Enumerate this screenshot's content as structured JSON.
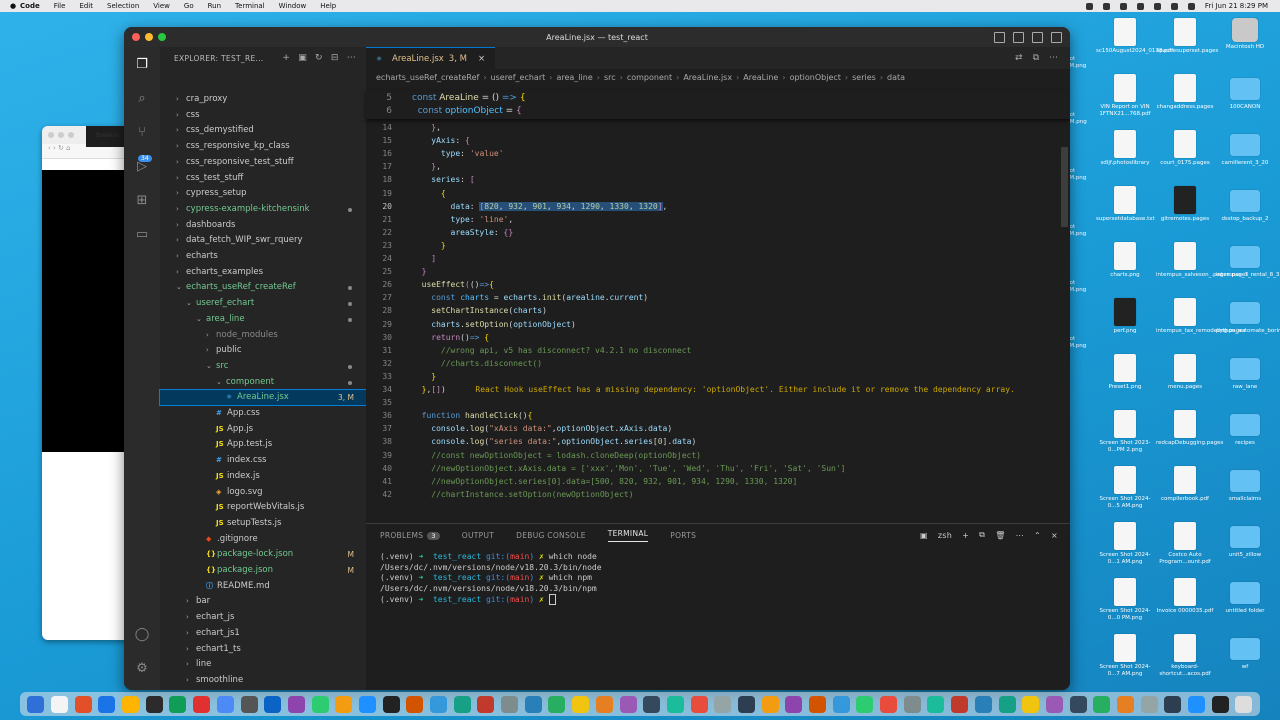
{
  "menubar": {
    "app": "Code",
    "items": [
      "File",
      "Edit",
      "Selection",
      "View",
      "Go",
      "Run",
      "Terminal",
      "Window",
      "Help"
    ],
    "clock": "Fri Jun 21  8:29 PM"
  },
  "browser": {
    "tab_label": "Breakin"
  },
  "desktop_icons": [
    {
      "label": "sc150August2024_0178.pdf"
    },
    {
      "label": "apachesuperset.pages"
    },
    {
      "label": "Macintosh HD"
    },
    {
      "label": "VIN Report on VIN 1FTNX21...768.pdf"
    },
    {
      "label": "changaddress.pages"
    },
    {
      "label": "100CANON"
    },
    {
      "label": "sdljf.photoslibrary"
    },
    {
      "label": "court_0175.pages"
    },
    {
      "label": "camillerent_3_20"
    },
    {
      "label": "supersetdatabase.txt"
    },
    {
      "label": "gitremotes.pages"
    },
    {
      "label": "dsstop_backup_2"
    },
    {
      "label": "charts.png"
    },
    {
      "label": "intempus_salveson_.pages.pages"
    },
    {
      "label": "intempus_7_rental_8_31_2023"
    },
    {
      "label": "perf.png"
    },
    {
      "label": "intempus_tax_remodeling.pages"
    },
    {
      "label": "python_automate_boring"
    },
    {
      "label": "Preset1.png"
    },
    {
      "label": "menu.pages"
    },
    {
      "label": "raw_lane"
    },
    {
      "label": "Screen Shot 2023-0...PM 2.png"
    },
    {
      "label": "redcapDebugging.pages"
    },
    {
      "label": "recipes"
    },
    {
      "label": "Screen Shot 2024-0...5 AM.png"
    },
    {
      "label": "compilerbook.pdf"
    },
    {
      "label": "smallclaims"
    },
    {
      "label": "Screen Shot 2024-0...1 AM.png"
    },
    {
      "label": "Costco Auto Program...ount.pdf"
    },
    {
      "label": "unit5_zillow"
    },
    {
      "label": "Screen Shot 2024-0...0 PM.png"
    },
    {
      "label": "Invoice 0000035.pdf"
    },
    {
      "label": "untitled folder"
    },
    {
      "label": "Screen Shot 2024-0...7 AM.png"
    },
    {
      "label": "keyboard-shortcut...acos.pdf"
    },
    {
      "label": "wf"
    }
  ],
  "desktop_partial": [
    "hot",
    "PM.png",
    "hot",
    "AM.png",
    "hot",
    "PM.png",
    "hot",
    "PM.png",
    "hot",
    "PM.png",
    "hot",
    "PM.png"
  ],
  "window": {
    "title": "AreaLine.jsx — test_react",
    "explorer_title": "EXPLORER: TEST_RE...",
    "badge_count": "34"
  },
  "tree": [
    {
      "label": "cra_proxy",
      "indent": 0,
      "type": "folder",
      "open": false
    },
    {
      "label": "css",
      "indent": 0,
      "type": "folder",
      "open": false
    },
    {
      "label": "css_demystified",
      "indent": 0,
      "type": "folder",
      "open": false
    },
    {
      "label": "css_responsive_kp_class",
      "indent": 0,
      "type": "folder",
      "open": false
    },
    {
      "label": "css_responsive_test_stuff",
      "indent": 0,
      "type": "folder",
      "open": false
    },
    {
      "label": "css_test_stuff",
      "indent": 0,
      "type": "folder",
      "open": false
    },
    {
      "label": "cypress_setup",
      "indent": 0,
      "type": "folder",
      "open": false
    },
    {
      "label": "cypress-example-kitchensink",
      "indent": 0,
      "type": "folder",
      "open": false,
      "green": true,
      "dot": true
    },
    {
      "label": "dashboards",
      "indent": 0,
      "type": "folder",
      "open": false
    },
    {
      "label": "data_fetch_WIP_swr_rquery",
      "indent": 0,
      "type": "folder",
      "open": false
    },
    {
      "label": "echarts",
      "indent": 0,
      "type": "folder",
      "open": false
    },
    {
      "label": "echarts_examples",
      "indent": 0,
      "type": "folder",
      "open": false
    },
    {
      "label": "echarts_useRef_createRef",
      "indent": 0,
      "type": "folder",
      "open": true,
      "green": true,
      "dot": true
    },
    {
      "label": "useref_echart",
      "indent": 1,
      "type": "folder",
      "open": true,
      "green": true,
      "dot": true
    },
    {
      "label": "area_line",
      "indent": 2,
      "type": "folder",
      "open": true,
      "green": true,
      "dot": true
    },
    {
      "label": "node_modules",
      "indent": 3,
      "type": "folder",
      "open": false,
      "dim": true
    },
    {
      "label": "public",
      "indent": 3,
      "type": "folder",
      "open": false
    },
    {
      "label": "src",
      "indent": 3,
      "type": "folder",
      "open": true,
      "green": true,
      "dot": true
    },
    {
      "label": "component",
      "indent": 4,
      "type": "folder",
      "open": true,
      "green": true,
      "dot": true
    },
    {
      "label": "AreaLine.jsx",
      "indent": 5,
      "type": "file",
      "icon": "jsx",
      "green": true,
      "selected": true,
      "mod": "3, M"
    },
    {
      "label": "App.css",
      "indent": 4,
      "type": "file",
      "icon": "css"
    },
    {
      "label": "App.js",
      "indent": 4,
      "type": "file",
      "icon": "js"
    },
    {
      "label": "App.test.js",
      "indent": 4,
      "type": "file",
      "icon": "js"
    },
    {
      "label": "index.css",
      "indent": 4,
      "type": "file",
      "icon": "css"
    },
    {
      "label": "index.js",
      "indent": 4,
      "type": "file",
      "icon": "js"
    },
    {
      "label": "logo.svg",
      "indent": 4,
      "type": "file",
      "icon": "svg"
    },
    {
      "label": "reportWebVitals.js",
      "indent": 4,
      "type": "file",
      "icon": "js"
    },
    {
      "label": "setupTests.js",
      "indent": 4,
      "type": "file",
      "icon": "js"
    },
    {
      "label": ".gitignore",
      "indent": 3,
      "type": "file",
      "icon": "git"
    },
    {
      "label": "package-lock.json",
      "indent": 3,
      "type": "file",
      "icon": "json",
      "green": true,
      "mod": "M"
    },
    {
      "label": "package.json",
      "indent": 3,
      "type": "file",
      "icon": "json",
      "green": true,
      "mod": "M"
    },
    {
      "label": "README.md",
      "indent": 3,
      "type": "file",
      "icon": "md"
    },
    {
      "label": "bar",
      "indent": 1,
      "type": "folder",
      "open": false
    },
    {
      "label": "echart_js",
      "indent": 1,
      "type": "folder",
      "open": false
    },
    {
      "label": "echart_js1",
      "indent": 1,
      "type": "folder",
      "open": false
    },
    {
      "label": "echart1_ts",
      "indent": 1,
      "type": "folder",
      "open": false
    },
    {
      "label": "line",
      "indent": 1,
      "type": "folder",
      "open": false
    },
    {
      "label": "smoothline",
      "indent": 1,
      "type": "folder",
      "open": false
    },
    {
      "label": "useref_js",
      "indent": 1,
      "type": "folder",
      "open": false
    }
  ],
  "editor_tab": {
    "label": "AreaLine.jsx",
    "status": "3, M"
  },
  "breadcrumb": [
    "echarts_useRef_createRef",
    "useref_echart",
    "area_line",
    "src",
    "component",
    "AreaLine.jsx",
    "AreaLine",
    "optionObject",
    "series",
    "data"
  ],
  "sticky": [
    {
      "ln": "5",
      "html": "<span class=\"kw\">const</span> <span class=\"fn\">AreaLine</span> = () <span class=\"kw\">=&gt;</span> <span class=\"br\">{</span>"
    },
    {
      "ln": "6",
      "html": "  <span class=\"kw\">const</span> <span class=\"cst\">optionObject</span> = <span class=\"ctl\">{</span>"
    }
  ],
  "code": [
    {
      "ln": "14",
      "html": "    <span class=\"ctl\">}</span>,"
    },
    {
      "ln": "15",
      "html": "    <span class=\"var\">yAxis</span>: <span class=\"ctl\">{</span>"
    },
    {
      "ln": "16",
      "html": "      <span class=\"var\">type</span>: <span class=\"str\">'value'</span>"
    },
    {
      "ln": "17",
      "html": "    <span class=\"ctl\">}</span>,"
    },
    {
      "ln": "18",
      "html": "    <span class=\"var\">series</span>: <span class=\"ctl\">[</span>"
    },
    {
      "ln": "19",
      "html": "      <span class=\"br\">{</span>"
    },
    {
      "ln": "20",
      "html": "        <span class=\"var\">data</span>: <span class=\"sel-bg\"><span class=\"ctl\">[</span><span class=\"num\">820</span>, <span class=\"num\">932</span>, <span class=\"num\">901</span>, <span class=\"num\">934</span>, <span class=\"num\">1290</span>, <span class=\"num\">1330</span>, <span class=\"num\">1320</span><span class=\"ctl\">]</span></span>,",
      "current": true
    },
    {
      "ln": "21",
      "html": "        <span class=\"var\">type</span>: <span class=\"str\">'line'</span>,"
    },
    {
      "ln": "22",
      "html": "        <span class=\"var\">areaStyle</span>: <span class=\"ctl\">{}</span>"
    },
    {
      "ln": "23",
      "html": "      <span class=\"br\">}</span>"
    },
    {
      "ln": "24",
      "html": "    <span class=\"ctl\">]</span>"
    },
    {
      "ln": "25",
      "html": "  <span class=\"ctl\">}</span>"
    },
    {
      "ln": "26",
      "html": "  <span class=\"fn\">useEffect</span><span class=\"ctl\">(</span>()<span class=\"kw\">=&gt;</span><span class=\"br\">{</span>"
    },
    {
      "ln": "27",
      "html": "    <span class=\"kw\">const</span> <span class=\"cst\">charts</span> = <span class=\"var\">echarts</span>.<span class=\"fn\">init</span>(<span class=\"var\">arealine</span>.<span class=\"var\">current</span>)"
    },
    {
      "ln": "28",
      "html": "    <span class=\"fn\">setChartInstance</span>(<span class=\"var\">charts</span>)"
    },
    {
      "ln": "29",
      "html": "    <span class=\"var\">charts</span>.<span class=\"fn\">setOption</span>(<span class=\"var\">optionObject</span>)"
    },
    {
      "ln": "30",
      "html": "    <span class=\"ctl\">return</span>()<span class=\"kw\">=&gt;</span> <span class=\"br\">{</span>"
    },
    {
      "ln": "31",
      "html": "      <span class=\"cm\">//wrong api, v5 has disconnect? v4.2.1 no disconnect</span>"
    },
    {
      "ln": "32",
      "html": "      <span class=\"cm\">//charts.disconnect()</span>"
    },
    {
      "ln": "33",
      "html": "    <span class=\"br\">}</span>"
    },
    {
      "ln": "34",
      "html": "  <span class=\"br\">}</span>,<span class=\"ctl\">[]</span>)  <span class=\"warn\">React Hook useEffect has a missing dependency: 'optionObject'. Either include it or remove the dependency array.</span>"
    },
    {
      "ln": "35",
      "html": ""
    },
    {
      "ln": "36",
      "html": "  <span class=\"kw\">function</span> <span class=\"fn\">handleClick</span>()<span class=\"br\">{</span>"
    },
    {
      "ln": "37",
      "html": "    <span class=\"var\">console</span>.<span class=\"fn\">log</span>(<span class=\"str\">\"xAxis data:\"</span>,<span class=\"var\">optionObject</span>.<span class=\"var\">xAxis</span>.<span class=\"var\">data</span>)"
    },
    {
      "ln": "38",
      "html": "    <span class=\"var\">console</span>.<span class=\"fn\">log</span>(<span class=\"str\">\"series data:\"</span>,<span class=\"var\">optionObject</span>.<span class=\"var\">series</span>[<span class=\"num\">0</span>].<span class=\"var\">data</span>)"
    },
    {
      "ln": "39",
      "html": "    <span class=\"cm\">//const newOptionObject = lodash.cloneDeep(optionObject)</span>"
    },
    {
      "ln": "40",
      "html": "    <span class=\"cm\">//newOptionObject.xAxis.data = ['xxx','Mon', 'Tue', 'Wed', 'Thu', 'Fri', 'Sat', 'Sun']</span>"
    },
    {
      "ln": "41",
      "html": "    <span class=\"cm\">//newOptionObject.series[0].data=[500, 820, 932, 901, 934, 1290, 1330, 1320]</span>"
    },
    {
      "ln": "42",
      "html": "    <span class=\"cm\">//chartInstance.setOption(newOptionObject)</span>"
    }
  ],
  "panel": {
    "tabs": [
      "PROBLEMS",
      "OUTPUT",
      "DEBUG CONSOLE",
      "TERMINAL",
      "PORTS"
    ],
    "problems_count": "3",
    "shell": "zsh",
    "terminal": [
      {
        "venv": "(.venv)",
        "arrow": "➜",
        "dir": "test_react",
        "git": "git:(",
        "branch": "main",
        "gitclose": ")",
        "x": "✗",
        "cmd": "which node"
      },
      {
        "out": "/Users/dc/.nvm/versions/node/v18.20.3/bin/node"
      },
      {
        "venv": "(.venv)",
        "arrow": "➜",
        "dir": "test_react",
        "git": "git:(",
        "branch": "main",
        "gitclose": ")",
        "x": "✗",
        "cmd": "which npm"
      },
      {
        "out": "/Users/dc/.nvm/versions/node/v18.20.3/bin/npm"
      },
      {
        "venv": "(.venv)",
        "arrow": "➜",
        "dir": "test_react",
        "git": "git:(",
        "branch": "main",
        "gitclose": ")",
        "x": "✗",
        "cmd": ""
      }
    ]
  },
  "dock_colors": [
    "#2f6fd8",
    "#f4f4f4",
    "#e34f26",
    "#1b73e8",
    "#ffb400",
    "#2b2b2b",
    "#0f9d58",
    "#e03030",
    "#4c8bf5",
    "#555",
    "#0b63c5",
    "#8e44ad",
    "#2ecc71",
    "#f39c12",
    "#1e90ff",
    "#222",
    "#d35400",
    "#3498db",
    "#16a085",
    "#c0392b",
    "#7f8c8d",
    "#2980b9",
    "#27ae60",
    "#f1c40f",
    "#e67e22",
    "#9b59b6",
    "#34495e",
    "#1abc9c",
    "#e74c3c",
    "#95a5a6",
    "#2c3e50",
    "#f39c12",
    "#8e44ad",
    "#d35400",
    "#3498db",
    "#2ecc71",
    "#e74c3c",
    "#7f8c8d",
    "#1abc9c",
    "#c0392b",
    "#2980b9",
    "#16a085",
    "#f1c40f",
    "#9b59b6",
    "#34495e",
    "#27ae60",
    "#e67e22",
    "#95a5a6",
    "#2c3e50",
    "#1e90ff",
    "#222",
    "#ddd"
  ]
}
